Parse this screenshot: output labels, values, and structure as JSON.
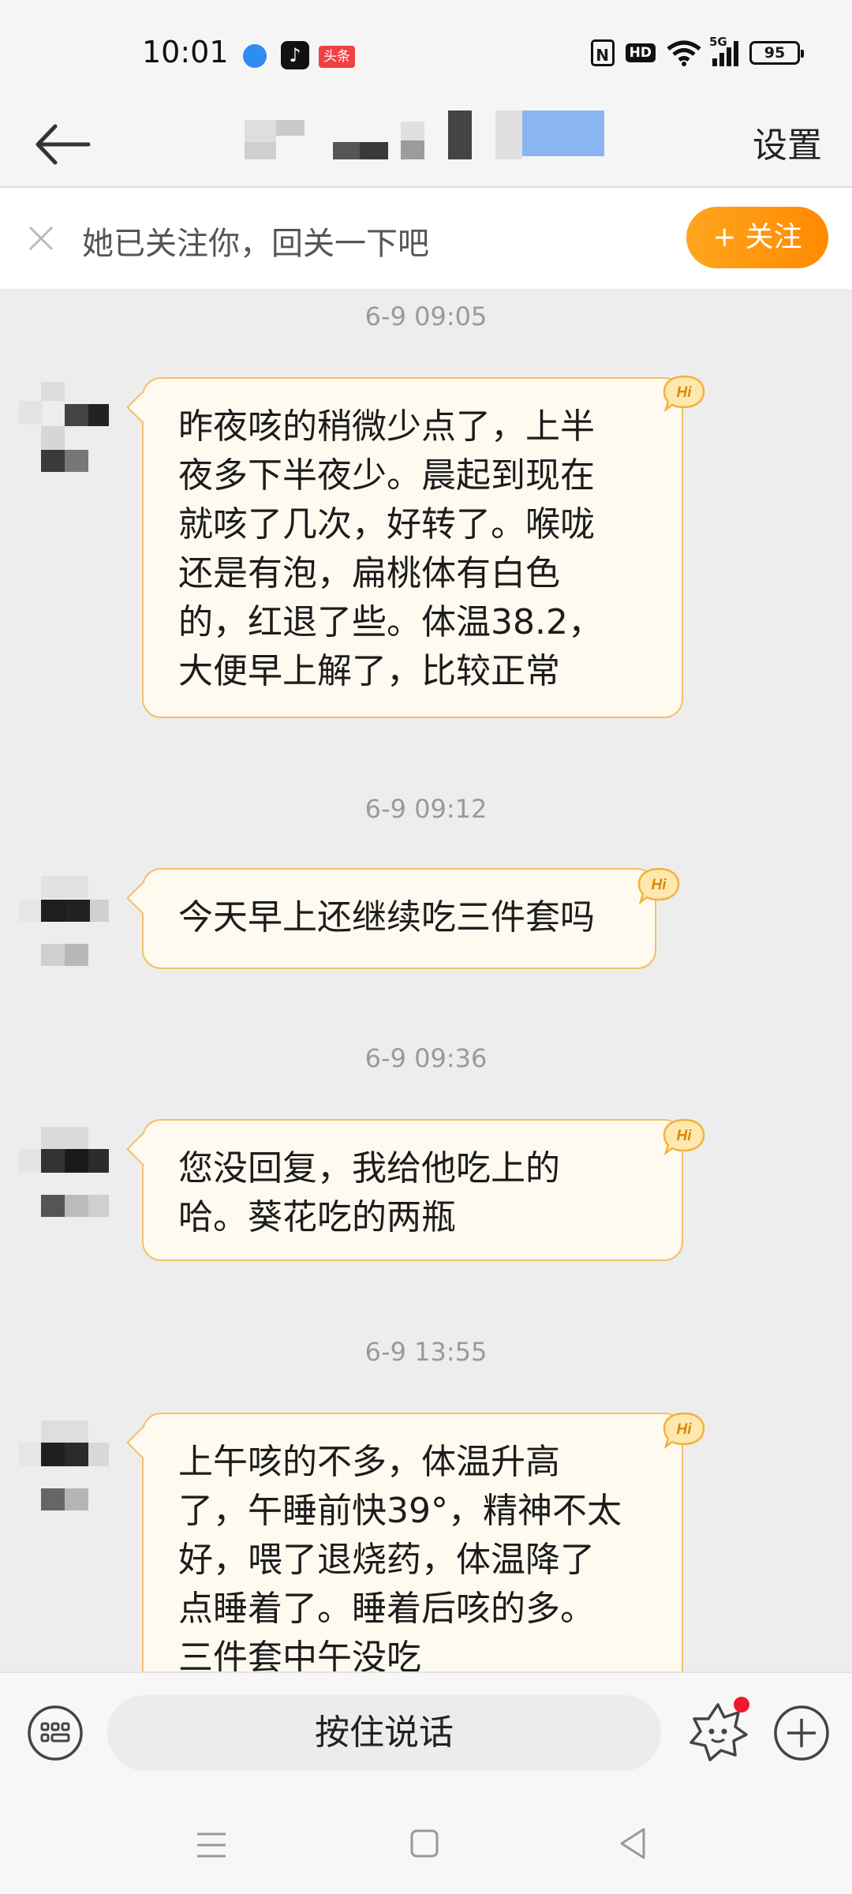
{
  "status_bar": {
    "time": "10:01",
    "apps": [
      "browser-icon",
      "tiktok-icon",
      "toutiao-icon"
    ],
    "toutiao_label": "头条",
    "nfc": "N",
    "hd": "HD",
    "network": "5G",
    "battery": "95"
  },
  "header": {
    "back_icon": "arrow-left-icon",
    "settings_label": "设置"
  },
  "follow_bar": {
    "text": "她已关注你，回关一下吧",
    "button_label": "+ 关注",
    "accent_color": "#ff9612"
  },
  "messages": [
    {
      "timestamp": "6-9 09:05",
      "lines": [
        "昨夜咳的稍微少点了，上半",
        "夜多下半夜少。晨起到现在",
        "就咳了几次，好转了。喉咙",
        "还是有泡，扁桃体有白色",
        "的，红退了些。体温38.2，",
        "大便早上解了，比较正常"
      ],
      "badge": "Hi"
    },
    {
      "timestamp": "6-9 09:12",
      "lines": [
        "今天早上还继续吃三件套吗"
      ],
      "badge": "Hi"
    },
    {
      "timestamp": "6-9 09:36",
      "lines": [
        "您没回复，我给他吃上的",
        "哈。葵花吃的两瓶"
      ],
      "badge": "Hi"
    },
    {
      "timestamp": "6-9 13:55",
      "lines": [
        "上午咳的不多，体温升高",
        "了，午睡前快39°，精神不太",
        "好，喂了退烧药，体温降了",
        "点睡着了。睡着后咳的多。",
        "三件套中午没吃"
      ],
      "badge": "Hi"
    }
  ],
  "input_bar": {
    "voice_label": "按住说话",
    "keyboard_icon": "keyboard-icon",
    "emoji_icon": "emoji-icon",
    "plus_icon": "plus-circle-icon"
  },
  "nav_bar": {
    "icons": [
      "menu-icon",
      "home-icon",
      "back-triangle-icon"
    ]
  }
}
